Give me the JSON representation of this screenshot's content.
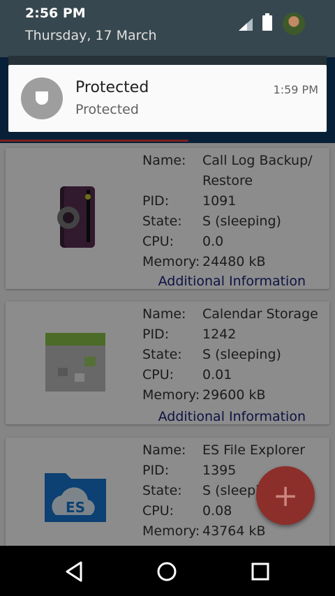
{
  "status": {
    "time": "2:56 PM",
    "date": "Thursday, 17 March"
  },
  "notification": {
    "title": "Protected",
    "time": "1:59 PM",
    "body": "Protected"
  },
  "processes": [
    {
      "name_label": "Name:",
      "name": "Call Log Backup/ Restore",
      "pid_label": "PID:",
      "pid": "1091",
      "state_label": "State:",
      "state": "S (sleeping)",
      "cpu_label": "CPU:",
      "cpu": "0.0",
      "mem_label": "Memory:",
      "memory": "24480 kB",
      "more": "Additional Information",
      "icon": "settings-box-icon"
    },
    {
      "name_label": "Name:",
      "name": "Calendar Storage",
      "pid_label": "PID:",
      "pid": "1242",
      "state_label": "State:",
      "state": "S (sleeping)",
      "cpu_label": "CPU:",
      "cpu": "0.01",
      "mem_label": "Memory:",
      "memory": "29600 kB",
      "more": "Additional Information",
      "icon": "calendar-icon"
    },
    {
      "name_label": "Name:",
      "name": "ES File Explorer",
      "pid_label": "PID:",
      "pid": "1395",
      "state_label": "State:",
      "state": "S (sleeping)",
      "cpu_label": "CPU:",
      "cpu": "0.08",
      "mem_label": "Memory:",
      "memory": "43764 kB",
      "icon": "es-folder-icon"
    }
  ],
  "fab": {
    "label": "+"
  },
  "colors": {
    "accent": "#e53935",
    "link": "#1a237e",
    "fab": "#e53935"
  }
}
